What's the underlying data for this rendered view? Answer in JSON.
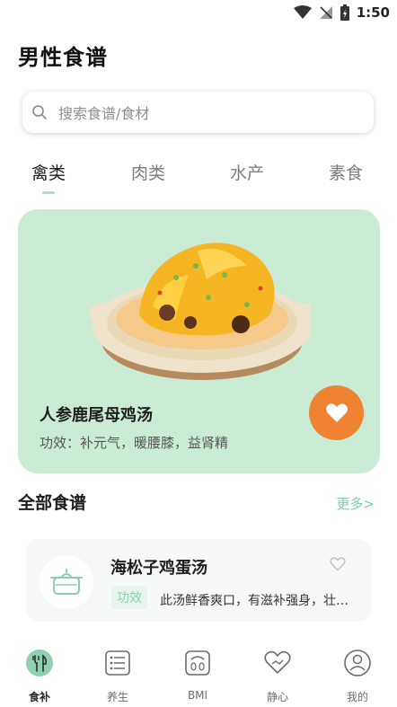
{
  "status_bar": {
    "time": "1:50"
  },
  "page": {
    "title": "男性食谱"
  },
  "search": {
    "placeholder": "搜索食谱/食材"
  },
  "tabs": [
    {
      "label": "禽类",
      "active": true
    },
    {
      "label": "肉类",
      "active": false
    },
    {
      "label": "水产",
      "active": false
    },
    {
      "label": "素食",
      "active": false
    }
  ],
  "featured": {
    "title": "人参鹿尾母鸡汤",
    "effect_label": "功效：",
    "effect_text": "补元气，暖腰膝，益肾精"
  },
  "section": {
    "title": "全部食谱",
    "more": "更多>"
  },
  "recipes": [
    {
      "name": "海松子鸡蛋汤",
      "tag": "功效",
      "desc": "此汤鲜香爽口，有滋补强身，壮阳..."
    }
  ],
  "nav": [
    {
      "label": "食补",
      "icon": "food-icon",
      "active": true
    },
    {
      "label": "养生",
      "icon": "list-icon",
      "active": false
    },
    {
      "label": "BMI",
      "icon": "scale-icon",
      "active": false
    },
    {
      "label": "静心",
      "icon": "heart-hand-icon",
      "active": false
    },
    {
      "label": "我的",
      "icon": "profile-icon",
      "active": false
    }
  ],
  "colors": {
    "accent_green": "#a9dfc3",
    "card_green": "#cbecd4",
    "fav_orange": "#f08331",
    "more_link": "#7ccfa6"
  }
}
